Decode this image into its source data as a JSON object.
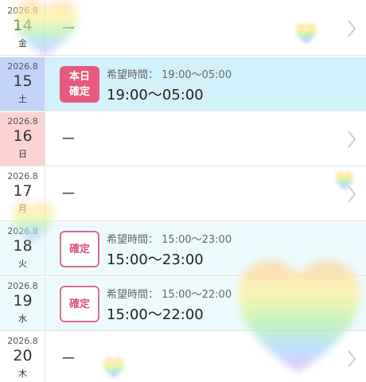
{
  "rows": [
    {
      "ym": "2026.8",
      "day": "14",
      "weekday": "金",
      "empty": "ー"
    },
    {
      "ym": "2026.8",
      "day": "15",
      "weekday": "土",
      "badge": [
        "本日",
        "確定"
      ],
      "hope_label": "希望時間：",
      "hope_time": "19:00〜05:00",
      "time": "19:00〜05:00"
    },
    {
      "ym": "2026.8",
      "day": "16",
      "weekday": "日",
      "empty": "ー"
    },
    {
      "ym": "2026.8",
      "day": "17",
      "weekday": "月",
      "empty": "ー"
    },
    {
      "ym": "2026.8",
      "day": "18",
      "weekday": "火",
      "badge": [
        "確定"
      ],
      "hope_label": "希望時間：",
      "hope_time": "15:00〜23:00",
      "time": "15:00〜23:00"
    },
    {
      "ym": "2026.8",
      "day": "19",
      "weekday": "水",
      "badge": [
        "確定"
      ],
      "hope_label": "希望時間：",
      "hope_time": "15:00〜22:00",
      "time": "15:00〜22:00"
    },
    {
      "ym": "2026.8",
      "day": "20",
      "weekday": "木",
      "empty": "ー"
    }
  ],
  "colors": {
    "today_row_bg": "#d3f1fb",
    "today_date_bg": "#c2d4f8",
    "sunday_date_bg": "#fbd3d3",
    "confirmed_row_bg": "#ecfafd",
    "badge_pink": "#e75a80"
  },
  "icons": {
    "chevron": "chevron-right-icon",
    "decoration": "rainbow-heart"
  }
}
